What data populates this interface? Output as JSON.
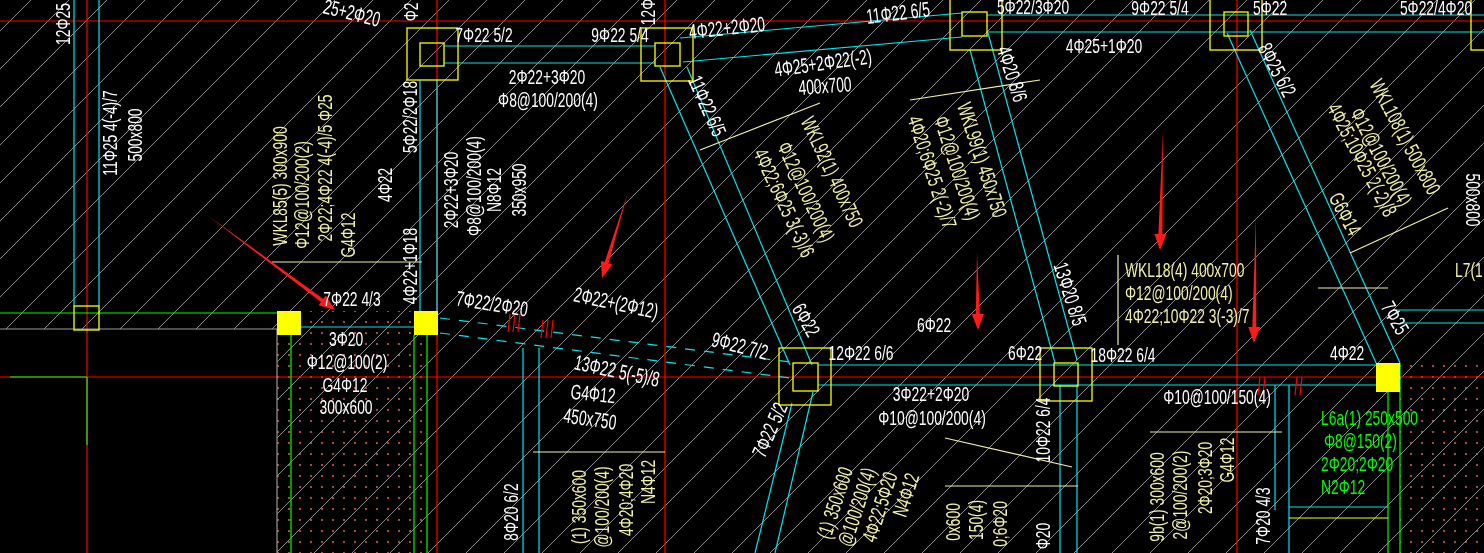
{
  "drawing": {
    "labels": [
      {
        "text": "12Φ25",
        "color": "#ffffff"
      },
      {
        "text": "25+2Φ20",
        "color": "#ffffff"
      },
      {
        "text": "Φ2",
        "color": "#ffffff"
      },
      {
        "text": "11Φ25 4(-4)/7",
        "color": "#ffffff"
      },
      {
        "text": "500x800",
        "color": "#ffffff"
      },
      {
        "text": "WKL85(5) 300x900",
        "color": "#f0f0a0"
      },
      {
        "text": "Φ12@100/200(2)",
        "color": "#f0f0a0"
      },
      {
        "text": "2Φ22;4Φ22 4(-4)/5 Φ25",
        "color": "#f0f0a0"
      },
      {
        "text": "G4Φ12",
        "color": "#f0f0a0"
      },
      {
        "text": "4Φ22",
        "color": "#ffffff"
      },
      {
        "text": "5Φ22/2Φ18",
        "color": "#ffffff"
      },
      {
        "text": "4Φ22+1Φ18",
        "color": "#ffffff"
      },
      {
        "text": "7Φ22 5/2",
        "color": "#ffffff"
      },
      {
        "text": "2Φ22+3Φ20",
        "color": "#ffffff"
      },
      {
        "text": "Φ8@100/200(4)",
        "color": "#ffffff"
      },
      {
        "text": "N8Φ12",
        "color": "#ffffff"
      },
      {
        "text": "350x950",
        "color": "#ffffff"
      },
      {
        "text": "2Φ22+3Φ20",
        "color": "#ffffff"
      },
      {
        "text": "Φ8@100/200(4)",
        "color": "#ffffff"
      },
      {
        "text": "9Φ22 5/4",
        "color": "#ffffff"
      },
      {
        "text": "12Φ",
        "color": "#ffffff"
      },
      {
        "text": "4Φ22+2Φ20",
        "color": "#ffffff"
      },
      {
        "text": "11Φ22 6/5",
        "color": "#ffffff"
      },
      {
        "text": "4Φ25+2Φ22(-2)",
        "color": "#ffffff"
      },
      {
        "text": "400x700",
        "color": "#ffffff"
      },
      {
        "text": "11Φ22 6/5",
        "color": "#ffffff"
      },
      {
        "text": "WKL92(1) 400x750",
        "color": "#f0f0a0"
      },
      {
        "text": "Φ12@100/200(4)",
        "color": "#f0f0a0"
      },
      {
        "text": "4Φ22;6Φ25 3(-3)/6",
        "color": "#f0f0a0"
      },
      {
        "text": "WKL99(1) 450x750",
        "color": "#f0f0a0"
      },
      {
        "text": "Φ12@100/200(4)",
        "color": "#f0f0a0"
      },
      {
        "text": "4Φ20;6Φ25 2(-2)/7",
        "color": "#f0f0a0"
      },
      {
        "text": "5Φ22/3Φ20",
        "color": "#ffffff"
      },
      {
        "text": "9Φ22 5/4",
        "color": "#ffffff"
      },
      {
        "text": "5Φ22",
        "color": "#ffffff"
      },
      {
        "text": "5Φ22/4Φ20",
        "color": "#ffffff"
      },
      {
        "text": "4Φ25+1Φ20",
        "color": "#ffffff"
      },
      {
        "text": "4Φ20 8/6",
        "color": "#ffffff"
      },
      {
        "text": "8Φ25 6/2",
        "color": "#ffffff"
      },
      {
        "text": "WKL108(1) 500x800",
        "color": "#f0f0a0"
      },
      {
        "text": "Φ12@100/200(4)",
        "color": "#f0f0a0"
      },
      {
        "text": "4Φ25;10Φ25 2(-2)/8",
        "color": "#f0f0a0"
      },
      {
        "text": "G6Φ14",
        "color": "#f0f0a0"
      },
      {
        "text": "500x800",
        "color": "#ffffff"
      },
      {
        "text": "L7(1",
        "color": "#f0f0a0"
      },
      {
        "text": "WKL18(4) 400x700",
        "color": "#f0f0a0"
      },
      {
        "text": "Φ12@100/200(4)",
        "color": "#f0f0a0"
      },
      {
        "text": "4Φ22;10Φ22 3(-3)/7",
        "color": "#f0f0a0"
      },
      {
        "text": "13Φ20 8/5",
        "color": "#ffffff"
      },
      {
        "text": "7Φ25",
        "color": "#ffffff"
      },
      {
        "text": "7Φ22 4/3",
        "color": "#ffffff"
      },
      {
        "text": "7Φ22/2Φ20",
        "color": "#ffffff"
      },
      {
        "text": "2Φ22+(2Φ12)",
        "color": "#ffffff"
      },
      {
        "text": "9Φ22 7/2",
        "color": "#ffffff"
      },
      {
        "text": "6Φ22",
        "color": "#ffffff"
      },
      {
        "text": "12Φ22 6/6",
        "color": "#ffffff"
      },
      {
        "text": "6Φ22",
        "color": "#ffffff"
      },
      {
        "text": "6Φ22",
        "color": "#ffffff"
      },
      {
        "text": "18Φ22 6/4",
        "color": "#ffffff"
      },
      {
        "text": "4Φ22",
        "color": "#ffffff"
      },
      {
        "text": "3Φ20",
        "color": "#ffffff"
      },
      {
        "text": "Φ12@100(2)",
        "color": "#ffffff"
      },
      {
        "text": "G4Φ12",
        "color": "#ffffff"
      },
      {
        "text": "300x600",
        "color": "#ffffff"
      },
      {
        "text": "13Φ22 5(-5)/8",
        "color": "#ffffff"
      },
      {
        "text": "G4Φ12",
        "color": "#ffffff"
      },
      {
        "text": "450x750",
        "color": "#ffffff"
      },
      {
        "text": "3Φ22+2Φ20",
        "color": "#ffffff"
      },
      {
        "text": "Φ10@100/200(4)",
        "color": "#ffffff"
      },
      {
        "text": "Φ10@100/150(4)",
        "color": "#ffffff"
      },
      {
        "text": "7Φ22 5/2",
        "color": "#ffffff"
      },
      {
        "text": "10Φ22 6/4",
        "color": "#ffffff"
      },
      {
        "text": "8Φ20 6/2",
        "color": "#ffffff"
      },
      {
        "text": "(1) 350x600",
        "color": "#f0f0a0"
      },
      {
        "text": "@100/200(4)",
        "color": "#f0f0a0"
      },
      {
        "text": "4Φ20;4Φ20",
        "color": "#f0f0a0"
      },
      {
        "text": "N4Φ12",
        "color": "#f0f0a0"
      },
      {
        "text": "(1) 350x600",
        "color": "#f0f0a0"
      },
      {
        "text": "@100/200(4)",
        "color": "#f0f0a0"
      },
      {
        "text": "4Φ22;5Φ20",
        "color": "#f0f0a0"
      },
      {
        "text": "N4Φ12",
        "color": "#f0f0a0"
      },
      {
        "text": "0x600",
        "color": "#f0f0a0"
      },
      {
        "text": "150(4)",
        "color": "#f0f0a0"
      },
      {
        "text": "0;6Φ20",
        "color": "#f0f0a0"
      },
      {
        "text": "Φ20",
        "color": "#ffffff"
      },
      {
        "text": "9b(1) 300x600",
        "color": "#f0f0a0"
      },
      {
        "text": "2@100/200(2)",
        "color": "#f0f0a0"
      },
      {
        "text": "2Φ20;3Φ20",
        "color": "#f0f0a0"
      },
      {
        "text": "G4Φ12",
        "color": "#f0f0a0"
      },
      {
        "text": "7Φ20 4/3",
        "color": "#ffffff"
      },
      {
        "text": "L6a(1) 250x500",
        "color": "#00ff00"
      },
      {
        "text": "Φ8@150(2)",
        "color": "#00ff00"
      },
      {
        "text": "2Φ20;2Φ20",
        "color": "#00ff00"
      },
      {
        "text": "N2Φ12",
        "color": "#00ff00"
      }
    ]
  }
}
